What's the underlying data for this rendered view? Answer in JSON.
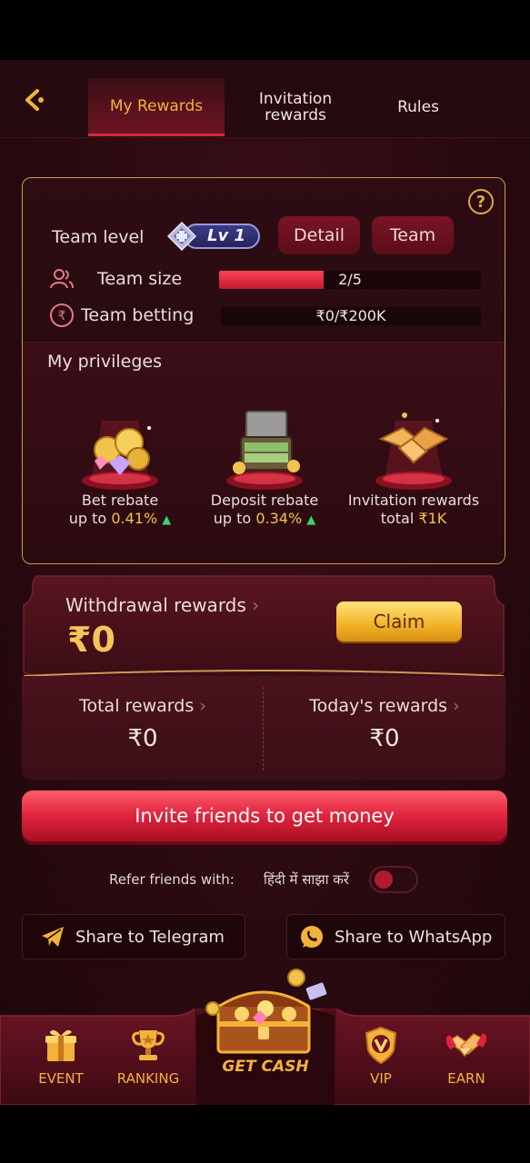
{
  "header": {
    "tabs": [
      {
        "label": "My Rewards",
        "active": true
      },
      {
        "label": "Invitation rewards",
        "active": false
      },
      {
        "label": "Rules",
        "active": false
      }
    ]
  },
  "team": {
    "level_label": "Team level",
    "level_badge": "Lv 1",
    "detail_label": "Detail",
    "team_label": "Team",
    "size_label": "Team size",
    "size_value": "2/5",
    "size_progress": 0.4,
    "betting_label": "Team betting",
    "betting_value": "₹0/₹200K",
    "betting_progress": 0
  },
  "privileges": {
    "title": "My privileges",
    "items": [
      {
        "name": "Bet rebate",
        "prefix": "up to",
        "value": "0.41%",
        "arrow": "▲"
      },
      {
        "name": "Deposit rebate",
        "prefix": "up to",
        "value": "0.34%",
        "arrow": "▲"
      },
      {
        "name": "Invitation rewards",
        "prefix": "total",
        "value": "₹1K",
        "arrow": ""
      }
    ],
    "active_page": 1,
    "page_count": 4
  },
  "withdrawal": {
    "title": "Withdrawal rewards",
    "amount": "₹0",
    "claim_label": "Claim"
  },
  "stats": {
    "total_label": "Total rewards",
    "total_value": "₹0",
    "today_label": "Today's rewards",
    "today_value": "₹0"
  },
  "invite_button": "Invite friends to get money",
  "refer": {
    "label": "Refer friends with:",
    "hindi_label": "हिंदी में साझा करें",
    "hindi_enabled": false
  },
  "share": {
    "telegram": "Share to Telegram",
    "whatsapp": "Share to WhatsApp"
  },
  "nav": {
    "event": "EVENT",
    "ranking": "RANKING",
    "get_cash": "GET CASH",
    "vip": "VIP",
    "earn": "EARN"
  },
  "colors": {
    "accent_gold": "#f3b23a",
    "accent_red": "#e0233c",
    "background": "#2a0a10"
  }
}
